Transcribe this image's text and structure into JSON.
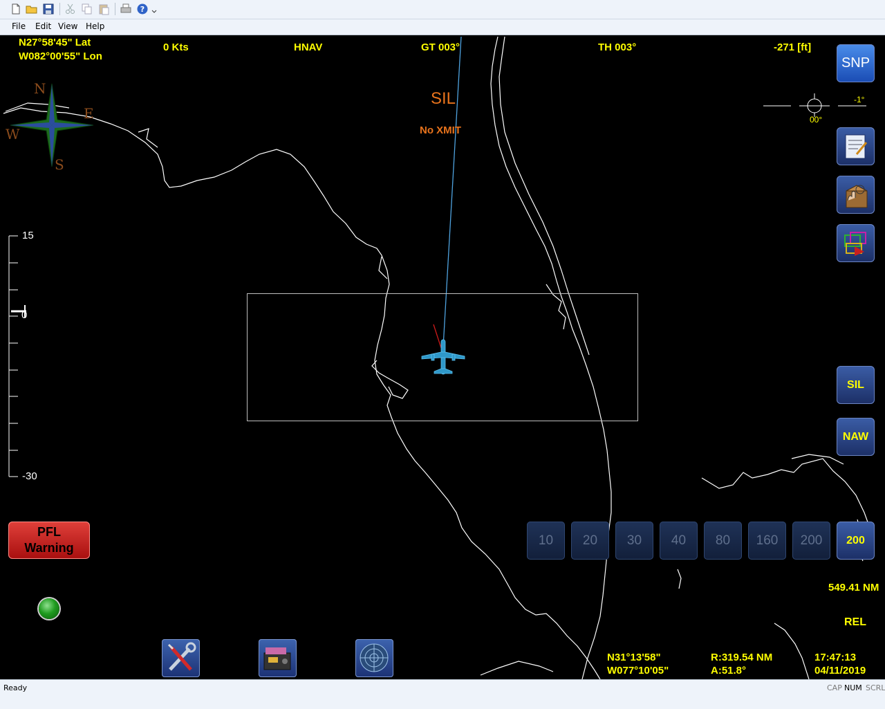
{
  "toolbar": {
    "icons": [
      "new-file-icon",
      "open-folder-icon",
      "save-icon",
      "cut-icon",
      "copy-icon",
      "paste-icon",
      "print-icon",
      "help-icon"
    ]
  },
  "menu": {
    "items": [
      "File",
      "Edit",
      "View",
      "Help"
    ]
  },
  "hud": {
    "lat": "N27°58'45\"  Lat",
    "lon": "W082°00'55\"  Lon",
    "speed": "0 Kts",
    "mode": "HNAV",
    "ground_track": "GT 003°",
    "true_heading": "TH 003°",
    "altitude": "-271 [ft]",
    "sil_label": "SIL",
    "xmit_label": "No XMIT"
  },
  "compass": {
    "n": "N",
    "e": "E",
    "s": "S",
    "w": "W"
  },
  "attitude": {
    "roll": "-1°",
    "pitch": "00°"
  },
  "vertical_scale": {
    "top": "15",
    "bottom": "-30",
    "marker": "0"
  },
  "right_buttons": {
    "snp": "SNP",
    "sil": "SIL",
    "naw": "NAW"
  },
  "zoom": {
    "buttons": [
      "10",
      "20",
      "30",
      "40",
      "80",
      "160",
      "200"
    ],
    "active": "200"
  },
  "distance": "549.41 NM",
  "rel_label": "REL",
  "pfl": {
    "line1": "PFL",
    "line2": "Warning"
  },
  "cursor": {
    "lat": "N31°13'58\"",
    "lon": "W077°10'05\""
  },
  "range": "R:319.54 NM",
  "azimuth": "A:51.8°",
  "time": "17:47:13",
  "date": "04/11/2019",
  "status": {
    "text": "Ready",
    "cap": "CAP",
    "num": "NUM",
    "scrl": "SCRL"
  },
  "colors": {
    "hud_text": "#ffff00",
    "alert": "#e8731c",
    "track": "#4fa3e0",
    "aircraft": "#2f98c9"
  }
}
